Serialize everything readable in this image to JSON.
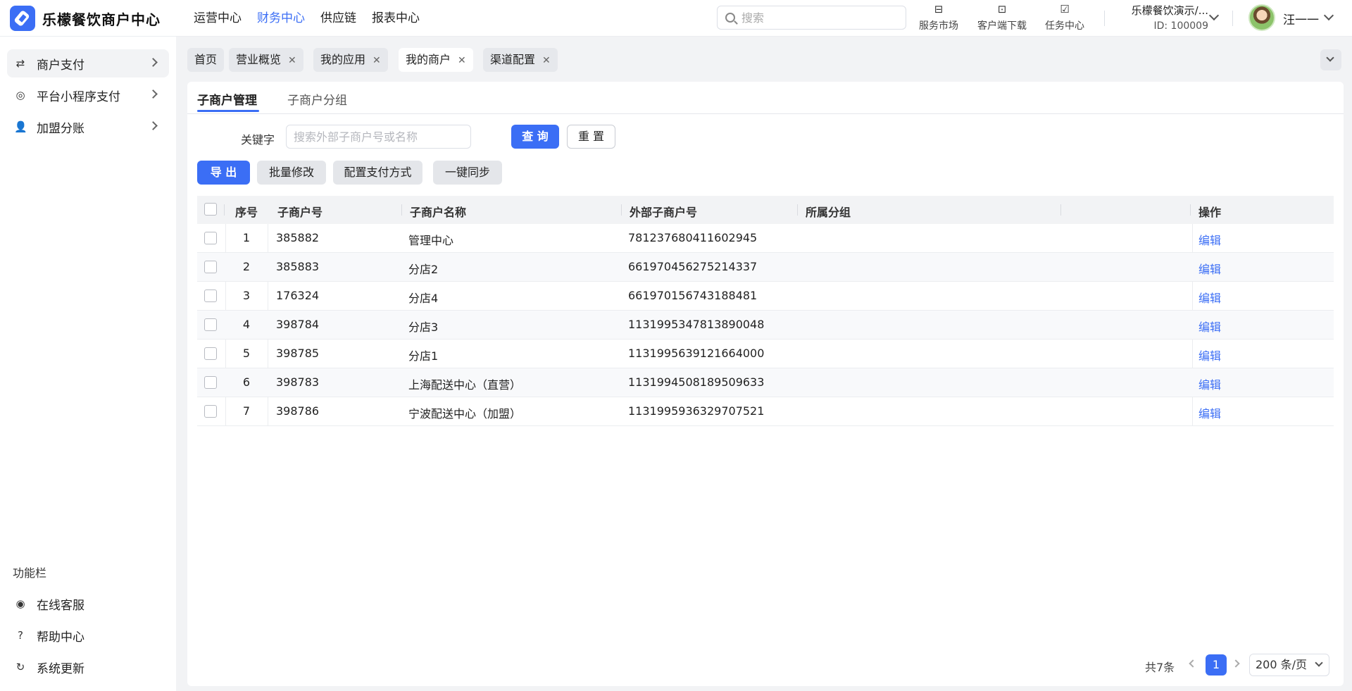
{
  "app": {
    "brand": "乐檬餐饮商户中心"
  },
  "topnav": [
    {
      "label": "运营中心",
      "active": false
    },
    {
      "label": "财务中心",
      "active": true
    },
    {
      "label": "供应链",
      "active": false
    },
    {
      "label": "报表中心",
      "active": false
    }
  ],
  "search": {
    "placeholder": "搜索"
  },
  "tools": {
    "market": "服务市场",
    "download": "客户端下载",
    "tasks": "任务中心"
  },
  "org": {
    "name": "乐檬餐饮演示/...",
    "id": "ID: 100009"
  },
  "user": {
    "name": "汪一一"
  },
  "sidebar": {
    "items": [
      {
        "label": "商户支付",
        "icon": "exchange-icon",
        "glyph": "⇄"
      },
      {
        "label": "平台小程序支付",
        "icon": "miniprogram-icon",
        "glyph": "◎"
      },
      {
        "label": "加盟分账",
        "icon": "add-user-icon",
        "glyph": "👤"
      }
    ],
    "section_title": "功能栏",
    "footer_items": [
      {
        "label": "在线客服",
        "icon": "headset-icon",
        "glyph": "◉"
      },
      {
        "label": "帮助中心",
        "icon": "help-icon",
        "glyph": "?"
      },
      {
        "label": "系统更新",
        "icon": "refresh-icon",
        "glyph": "↻"
      }
    ]
  },
  "tabs": [
    {
      "label": "首页",
      "closable": false
    },
    {
      "label": "营业概览",
      "closable": true
    },
    {
      "label": "我的应用",
      "closable": true
    },
    {
      "label": "我的商户",
      "closable": true,
      "active": true
    },
    {
      "label": "渠道配置",
      "closable": true
    }
  ],
  "subtabs": [
    {
      "label": "子商户管理",
      "active": true
    },
    {
      "label": "子商户分组",
      "active": false
    }
  ],
  "filter": {
    "keyword_label": "关键字",
    "keyword_placeholder": "搜索外部子商户号或名称",
    "query_label": "查 询",
    "reset_label": "重 置"
  },
  "actions": {
    "export": "导 出",
    "batch_edit": "批量修改",
    "config_payment": "配置支付方式",
    "sync": "一键同步"
  },
  "table": {
    "columns": [
      "序号",
      "子商户号",
      "子商户名称",
      "外部子商户号",
      "所属分组",
      "",
      "操作"
    ],
    "rows": [
      {
        "seq": "1",
        "id": "385882",
        "name": "管理中心",
        "ext_id": "781237680411602945",
        "group": "",
        "action": "编辑"
      },
      {
        "seq": "2",
        "id": "385883",
        "name": "分店2",
        "ext_id": "661970456275214337",
        "group": "",
        "action": "编辑"
      },
      {
        "seq": "3",
        "id": "176324",
        "name": "分店4",
        "ext_id": "661970156743188481",
        "group": "",
        "action": "编辑"
      },
      {
        "seq": "4",
        "id": "398784",
        "name": "分店3",
        "ext_id": "1131995347813890048",
        "group": "",
        "action": "编辑"
      },
      {
        "seq": "5",
        "id": "398785",
        "name": "分店1",
        "ext_id": "1131995639121664000",
        "group": "",
        "action": "编辑"
      },
      {
        "seq": "6",
        "id": "398783",
        "name": "上海配送中心（直营）",
        "ext_id": "1131994508189509633",
        "group": "",
        "action": "编辑"
      },
      {
        "seq": "7",
        "id": "398786",
        "name": "宁波配送中心（加盟）",
        "ext_id": "1131995936329707521",
        "group": "",
        "action": "编辑"
      }
    ]
  },
  "pagination": {
    "total": "共7条",
    "current": "1",
    "page_size": "200 条/页"
  },
  "colors": {
    "accent": "#3b6ef5",
    "bg": "#f2f3f5"
  }
}
